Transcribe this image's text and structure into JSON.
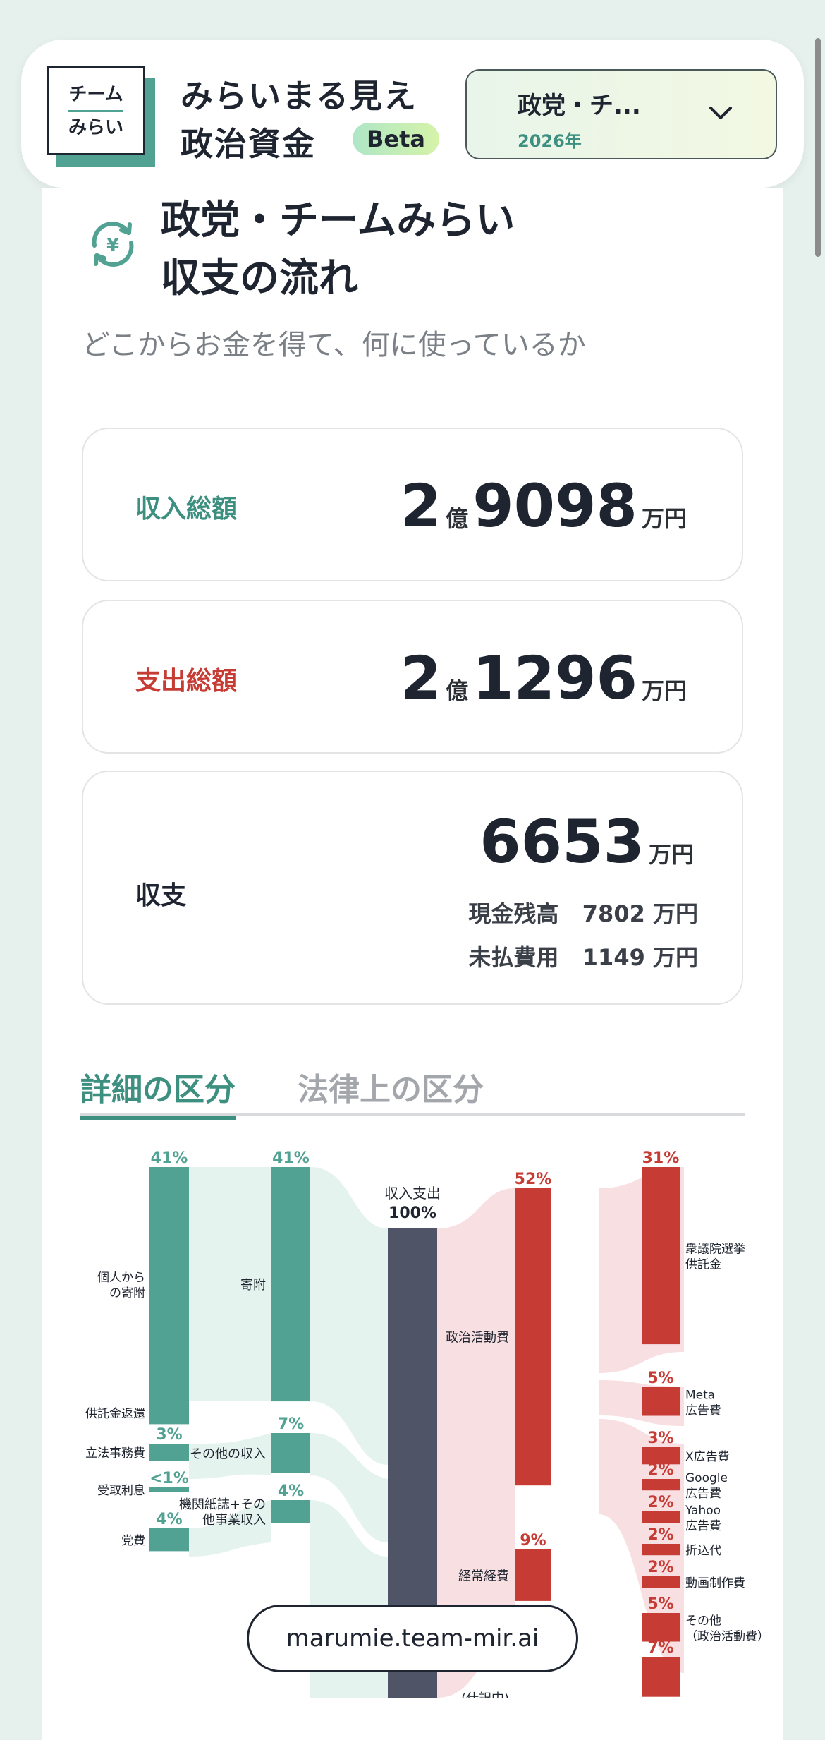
{
  "header": {
    "logo": {
      "line1": "チーム",
      "line2": "みらい"
    },
    "title_line1": "みらいまる見え",
    "title_line2": "政治資金",
    "badge": "Beta",
    "org_select": {
      "name": "政党・チ...",
      "year": "2026年",
      "icon": "chevron-down-icon"
    }
  },
  "section": {
    "icon": "yen-refresh-icon",
    "title_line1": "政党・チームみらい",
    "title_line2": "収支の流れ",
    "subtitle": "どこからお金を得て、何に使っているか"
  },
  "summary": {
    "income": {
      "label": "収入総額",
      "oku": "2",
      "oku_unit": "億",
      "man": "9098",
      "man_unit": "万円"
    },
    "expense": {
      "label": "支出総額",
      "oku": "2",
      "oku_unit": "億",
      "man": "1296",
      "man_unit": "万円"
    },
    "balance": {
      "label": "収支",
      "value": "6653",
      "unit": "万円",
      "cash_label": "現金残高",
      "cash_value": "7802",
      "cash_unit": "万円",
      "unpaid_label": "未払費用",
      "unpaid_value": "1149",
      "unpaid_unit": "万円"
    }
  },
  "tabs": [
    {
      "label": "詳細の区分",
      "active": true
    },
    {
      "label": "法律上の区分",
      "active": false
    }
  ],
  "sankey": {
    "income_sources": [
      {
        "label1": "個人から",
        "label2": "の寄附",
        "pct": "41%",
        "value": 41
      },
      {
        "label1": "供託金返還",
        "label2": "",
        "pct": "4%",
        "value": 4
      },
      {
        "label1": "立法事務費",
        "label2": "",
        "pct": "3%",
        "value": 3
      },
      {
        "label1": "受取利息",
        "label2": "",
        "pct": "<1%",
        "value": 0.5
      },
      {
        "label1": "党費",
        "label2": "",
        "pct": "4%",
        "value": 4
      }
    ],
    "income_categories": [
      {
        "label1": "寄附",
        "label2": "",
        "pct": "41%",
        "value": 41
      },
      {
        "label1": "その他の収入",
        "label2": "",
        "pct": "7%",
        "value": 7
      },
      {
        "label1": "機関紙誌+その",
        "label2": "他事業収入",
        "pct": "4%",
        "value": 4
      }
    ],
    "center": {
      "label": "収入支出",
      "pct": "100%"
    },
    "expense_categories": [
      {
        "label1": "政治活動費",
        "label2": "",
        "pct": "52%",
        "value": 52
      },
      {
        "label1": "経常経費",
        "label2": "",
        "pct": "9%",
        "value": 9
      },
      {
        "label1": "(仕訳中)",
        "label2": "",
        "pct": "",
        "value": 0
      }
    ],
    "expense_items": [
      {
        "label1": "衆議院選挙",
        "label2": "供託金",
        "pct": "31%",
        "value": 31
      },
      {
        "label1": "Meta",
        "label2": "広告費",
        "pct": "5%",
        "value": 5
      },
      {
        "label1": "X広告費",
        "label2": "",
        "pct": "3%",
        "value": 3
      },
      {
        "label1": "Google",
        "label2": "広告費",
        "pct": "2%",
        "value": 2
      },
      {
        "label1": "Yahoo",
        "label2": "広告費",
        "pct": "2%",
        "value": 2
      },
      {
        "label1": "折込代",
        "label2": "",
        "pct": "2%",
        "value": 2
      },
      {
        "label1": "動画制作費",
        "label2": "",
        "pct": "2%",
        "value": 2
      },
      {
        "label1": "その他",
        "label2": "（政治活動費）",
        "pct": "5%",
        "value": 5
      },
      {
        "label1": "",
        "label2": "",
        "pct": "7%",
        "value": 7
      }
    ],
    "colors": {
      "income": "#52a294",
      "income_flow": "#e5f3ee",
      "center": "#4f5467",
      "expense": "#c73b35",
      "expense_flow": "#f8dfe2"
    }
  },
  "footer": {
    "url": "marumie.team-mir.ai"
  }
}
